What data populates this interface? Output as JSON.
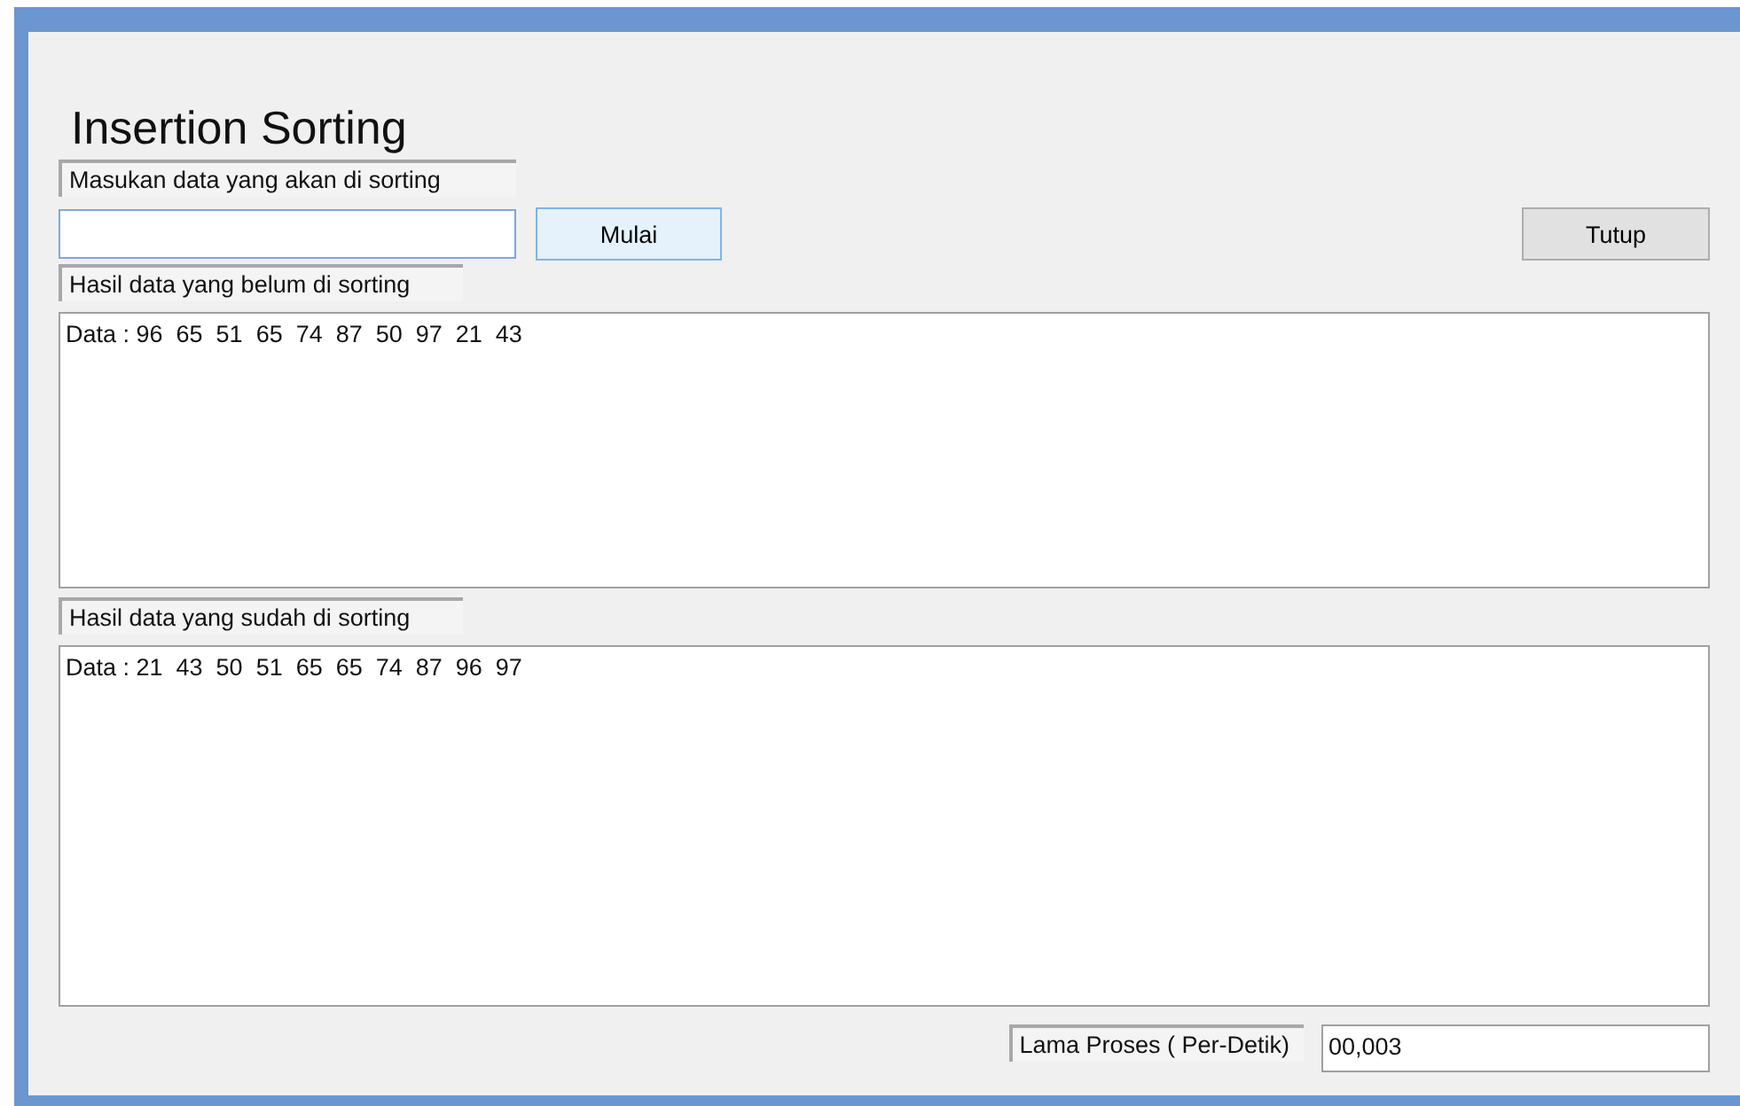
{
  "window": {
    "heading": "Insertion Sorting"
  },
  "input_section": {
    "label": "Masukan data yang akan di sorting",
    "start_button": "Mulai",
    "close_button": "Tutup"
  },
  "unsorted": {
    "label": "Hasil data yang belum di sorting",
    "value": "Data : 96  65  51  65  74  87  50  97  21  43"
  },
  "sorted": {
    "label": "Hasil data yang sudah di sorting",
    "value": "Data : 21  43  50  51  65  65  74  87  96  97"
  },
  "duration": {
    "label": "Lama Proses ( Per-Detik)",
    "value": "00,003"
  }
}
